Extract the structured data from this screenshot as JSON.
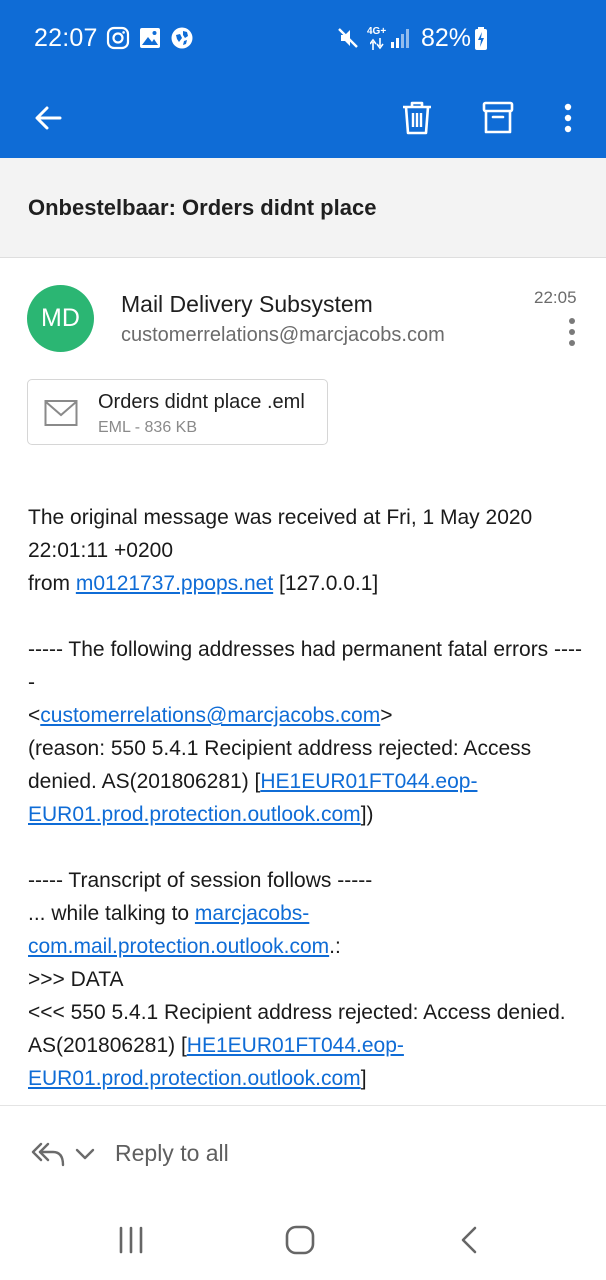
{
  "status_bar": {
    "time": "22:07",
    "network": "4G+",
    "battery": "82%",
    "icons": [
      "instagram-icon",
      "gallery-icon",
      "vpn-icon",
      "mute-icon",
      "signal-icon",
      "battery-charging-icon"
    ]
  },
  "app_bar": {
    "icons": [
      "back-arrow-icon",
      "trash-icon",
      "archive-icon",
      "more-vertical-icon"
    ],
    "color": "#0f6cd6"
  },
  "message": {
    "subject": "Onbestelbaar: Orders didnt place",
    "sender": {
      "initials": "MD",
      "name": "Mail Delivery Subsystem",
      "email": "customerrelations@marcjacobs.com",
      "avatar_color": "#2bb673"
    },
    "time": "22:05",
    "attachment": {
      "name": "Orders didnt place .eml",
      "meta": "EML - 836 KB"
    },
    "body": {
      "p1_line1": "The original message was received at Fri, 1 May 2020 22:01:11 +0200",
      "p1_from": "from ",
      "p1_host_link": "m0121737.ppops.net",
      "p1_ip": " [127.0.0.1]",
      "p2_header": "----- The following addresses had permanent fatal errors -----",
      "p2_lt": "<",
      "p2_email_link": "customerrelations@marcjacobs.com",
      "p2_gt": ">",
      "p2_reason": "(reason: 550 5.4.1 Recipient address rejected: Access denied. AS(201806281) [",
      "p2_server_link": "HE1EUR01FT044.eop-EUR01.prod.protection.outlook.com",
      "p2_reason_end": "])",
      "p3_header": "----- Transcript of session follows -----",
      "p3_talking": "... while talking to ",
      "p3_mx_link": "marcjacobs-com.mail.protection.outlook.com",
      "p3_talking_end": ".:",
      "p3_data": ">>> DATA",
      "p3_reject": "<<< 550 5.4.1 Recipient address rejected: Access denied. AS(201806281) [",
      "p3_server_link": "HE1EUR01FT044.eop-EUR01.prod.protection.outlook.com",
      "p3_reject_end": "]"
    }
  },
  "reply_bar": {
    "label": "Reply to all",
    "icons": [
      "reply-all-icon",
      "chevron-down-icon"
    ]
  },
  "nav_bar": {
    "icons": [
      "recent-apps-icon",
      "home-icon",
      "back-icon"
    ]
  }
}
